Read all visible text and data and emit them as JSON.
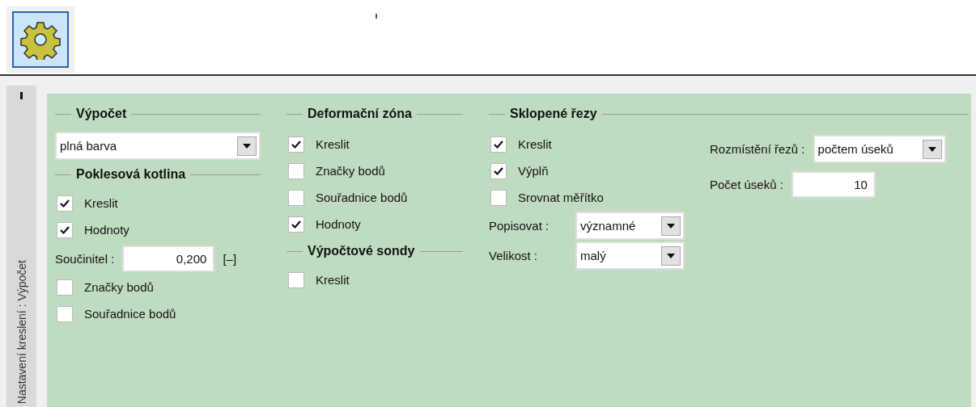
{
  "toolbar": {
    "settings_button": {
      "selected": true
    }
  },
  "side_tab": {
    "label": "Nastavení kreslení : Výpočet"
  },
  "columns": [
    {
      "title": "Výpočet",
      "items": [
        {
          "kind": "select",
          "value": "plná barva"
        },
        {
          "kind": "header",
          "label": "Poklesová kotlina"
        },
        {
          "kind": "checkbox",
          "label": "Kreslit",
          "checked": true
        },
        {
          "kind": "checkbox",
          "label": "Hodnoty",
          "checked": true
        },
        {
          "kind": "number",
          "label": "Součinitel :",
          "value": "0,200",
          "unit": "[–]"
        },
        {
          "kind": "checkbox",
          "label": "Značky bodů",
          "checked": false
        },
        {
          "kind": "checkbox",
          "label": "Souřadnice bodů",
          "checked": false
        }
      ]
    },
    {
      "title": "Deformační zóna",
      "items": [
        {
          "kind": "checkbox",
          "label": "Kreslit",
          "checked": true
        },
        {
          "kind": "checkbox",
          "label": "Značky bodů",
          "checked": false
        },
        {
          "kind": "checkbox",
          "label": "Souřadnice bodů",
          "checked": false
        },
        {
          "kind": "checkbox",
          "label": "Hodnoty",
          "checked": true
        },
        {
          "kind": "header",
          "label": "Výpočtové sondy"
        },
        {
          "kind": "checkbox",
          "label": "Kreslit",
          "checked": false
        }
      ]
    },
    {
      "title": "Sklopené řezy",
      "items": [
        {
          "kind": "checkbox",
          "label": "Kreslit",
          "checked": true
        },
        {
          "kind": "checkbox",
          "label": "Výplň",
          "checked": true
        },
        {
          "kind": "checkbox",
          "label": "Srovnat měřítko",
          "checked": false
        },
        {
          "kind": "select",
          "label": "Popisovat :",
          "value": "významné"
        },
        {
          "kind": "select",
          "label": "Velikost :",
          "value": "malý"
        }
      ],
      "aside": [
        {
          "kind": "select",
          "label": "Rozmístění řezů :",
          "value": "počtem úseků"
        },
        {
          "kind": "number",
          "label": "Počet úseků :",
          "value": "10"
        }
      ]
    }
  ]
}
